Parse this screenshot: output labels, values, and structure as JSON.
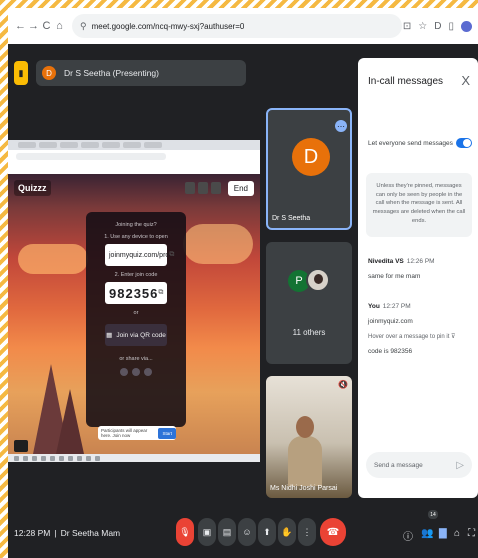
{
  "browser": {
    "url": "meet.google.com/ncq-mwy-sxj?authuser=0",
    "nav": [
      "←",
      "→",
      "C",
      "⌂"
    ],
    "right_icons": [
      "⊡",
      "☆",
      "D",
      "▯"
    ]
  },
  "meet": {
    "presenting_label": "Dr S Seetha (Presenting)",
    "presenter_initial": "D"
  },
  "shared_screen": {
    "app_logo": "Quizzz",
    "end_label": "End",
    "join_title": "Joining the quiz?",
    "step1": "1. Use any device to open",
    "join_url": "joinmyquiz.com/pro",
    "step2": "2. Enter join code",
    "code": "982356",
    "or": "or",
    "qr_label": "Join via QR code",
    "share_via": "or share via...",
    "notif_text": "Participants will appear here. Join now",
    "notif_btn": "Start"
  },
  "tiles": [
    {
      "name": "Dr S Seetha",
      "initial": "D"
    },
    {
      "name": "11 others",
      "initial": "P"
    },
    {
      "name": "Ms Nidhi Joshi Parsai"
    }
  ],
  "panel": {
    "title": "In-call messages",
    "close": "X",
    "toggle_label": "Let everyone send messages",
    "info": "Unless they're pinned, messages can only be seen by people in the call when the message is sent. All messages are deleted when the call ends.",
    "messages": [
      {
        "who": "Nivedita VS",
        "time": "12:26 PM",
        "lines": [
          "same for me mam"
        ]
      },
      {
        "who": "You",
        "time": "12:27 PM",
        "lines": [
          "joinmyquiz.com",
          "code is 982356"
        ],
        "hint": "Hover over a message to pin it ⊽"
      }
    ],
    "send_placeholder": "Send a message",
    "send_icon": "▷"
  },
  "bottom": {
    "time": "12:28 PM",
    "separator": "|",
    "meeting_name": "Dr Seetha Mam",
    "controls": [
      "🎙",
      "▣",
      "▤",
      "☺",
      "⬆",
      "✋",
      "⋮"
    ],
    "end_icon": "☎",
    "right_icons": [
      "ⓘ",
      "👥",
      "▇",
      "⌂",
      "⛶"
    ],
    "participant_count": "14"
  }
}
